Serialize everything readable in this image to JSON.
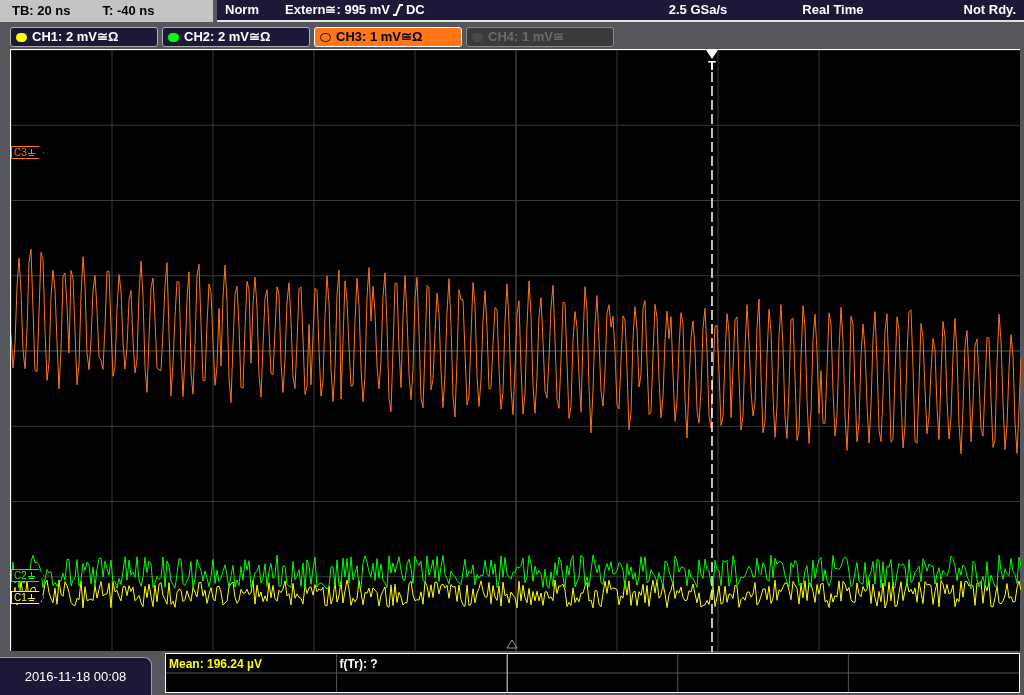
{
  "timebase": {
    "tb": "TB: 20 ns",
    "t": "T: -40 ns"
  },
  "status": {
    "mode": "Norm",
    "trigger_source": "Extern≅: 995 mV",
    "trigger_coupling": "DC",
    "sample_rate": "2.5 GSa/s",
    "acquisition": "Real Time",
    "state": "Not Rdy."
  },
  "channels": [
    {
      "label": "CH1: 2 mV≅Ω",
      "color": "#ffff00",
      "selected": false,
      "on": true
    },
    {
      "label": "CH2: 2 mV≅Ω",
      "color": "#00ff00",
      "selected": false,
      "on": true
    },
    {
      "label": "CH3: 1 mV≅Ω",
      "color": "#ff7518",
      "selected": true,
      "on": true
    },
    {
      "label": "CH4: 1 mV≅",
      "color": "#4a4a4a",
      "selected": false,
      "on": false
    }
  ],
  "markers": [
    {
      "label": "C3",
      "color": "#ff7518"
    },
    {
      "label": "C2",
      "color": "#00ff00"
    },
    {
      "label": "C1",
      "color": "#ffff00"
    }
  ],
  "trigger": {
    "label": "T"
  },
  "date": "2016-11-18 00:08",
  "measurements": [
    {
      "text": "Mean: 196.24 µV",
      "color": "#ffff00"
    },
    {
      "text": "f(Tr): ?",
      "color": "#ffffff"
    }
  ]
}
